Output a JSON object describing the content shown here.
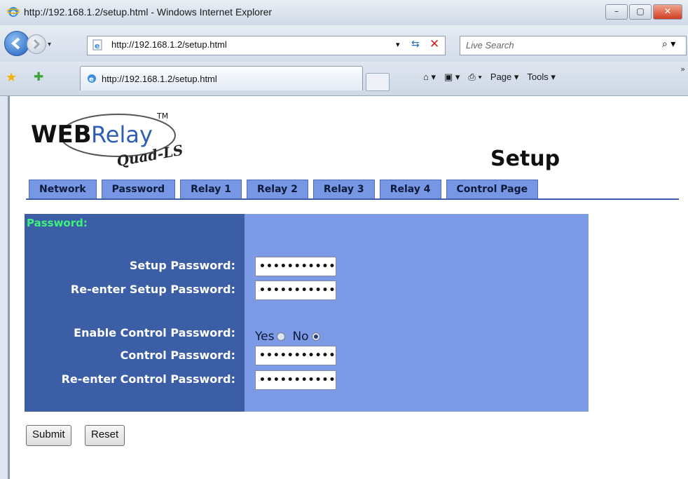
{
  "window": {
    "title": "http://192.168.1.2/setup.html - Windows Internet Explorer",
    "minimize": "–",
    "maximize": "▢",
    "close": "✕"
  },
  "address_bar": {
    "url": "http://192.168.1.2/setup.html",
    "search_placeholder": "Live Search"
  },
  "toolbar": {
    "tab_label": "http://192.168.1.2/setup.html",
    "home": "⌂ ▾",
    "feeds": "▣ ▾",
    "print": "⎙ ▾",
    "page_label": "Page ▾",
    "tools_label": "Tools ▾",
    "more": "»"
  },
  "page": {
    "logo_web": "WEB",
    "logo_relay": "Relay",
    "logo_tm": "TM",
    "logo_quad": "Quad-LS",
    "title": "Setup",
    "tabs": [
      "Network",
      "Password",
      "Relay 1",
      "Relay 2",
      "Relay 3",
      "Relay 4",
      "Control Page"
    ],
    "section": "Password:",
    "fields": {
      "setup_password_label": "Setup Password:",
      "setup_password_value": "•••••••••••",
      "reenter_setup_label": "Re-enter Setup Password:",
      "reenter_setup_value": "•••••••••••",
      "enable_control_label": "Enable Control Password:",
      "yes_label": "Yes",
      "no_label": "No",
      "enable_control_selected": "No",
      "control_password_label": "Control Password:",
      "control_password_value": "•••••••••••",
      "reenter_control_label": "Re-enter Control Password:",
      "reenter_control_value": "•••••••••••"
    },
    "buttons": {
      "submit": "Submit",
      "reset": "Reset"
    }
  },
  "colors": {
    "tab_bg": "#7797e4",
    "left_panel": "#3b5ea6",
    "right_panel": "#7d9ae6",
    "section_label": "#3ef07c"
  }
}
